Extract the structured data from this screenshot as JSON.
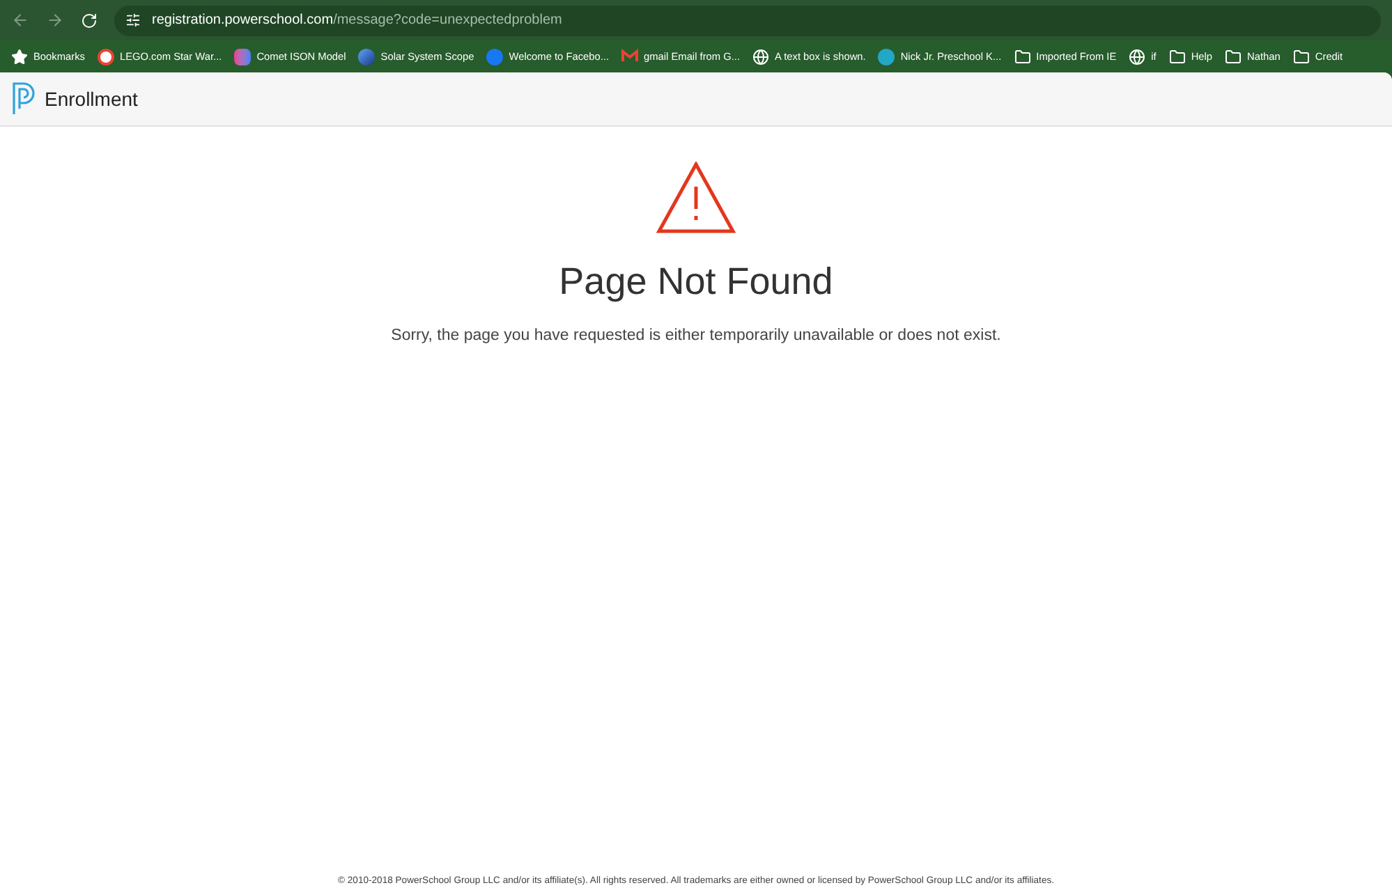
{
  "browser": {
    "url_host": "registration.powerschool.com",
    "url_path": "/message?code=unexpectedproblem"
  },
  "bookmarks": [
    {
      "kind": "star",
      "label": "Bookmarks"
    },
    {
      "kind": "google",
      "label": "LEGO.com Star War..."
    },
    {
      "kind": "app",
      "label": "Comet ISON Model"
    },
    {
      "kind": "sphere",
      "label": "Solar System Scope"
    },
    {
      "kind": "facebook",
      "label": "Welcome to Facebo..."
    },
    {
      "kind": "mail",
      "label": "gmail Email from G..."
    },
    {
      "kind": "globe",
      "label": "A text box is shown."
    },
    {
      "kind": "badge",
      "label": "Nick Jr.  Preschool K..."
    },
    {
      "kind": "folder",
      "label": "Imported From IE"
    },
    {
      "kind": "globe",
      "label": "if"
    },
    {
      "kind": "folder",
      "label": "Help"
    },
    {
      "kind": "folder",
      "label": "Nathan"
    },
    {
      "kind": "folder",
      "label": "Credit"
    }
  ],
  "header": {
    "title": "Enrollment"
  },
  "message": {
    "title": "Page Not Found",
    "text": "Sorry, the page you have requested is either temporarily unavailable or does not exist."
  },
  "footer": "© 2010-2018 PowerSchool Group LLC and/or its affiliate(s). All rights reserved. All trademarks are either owned or licensed by PowerSchool Group LLC and/or its affiliates."
}
